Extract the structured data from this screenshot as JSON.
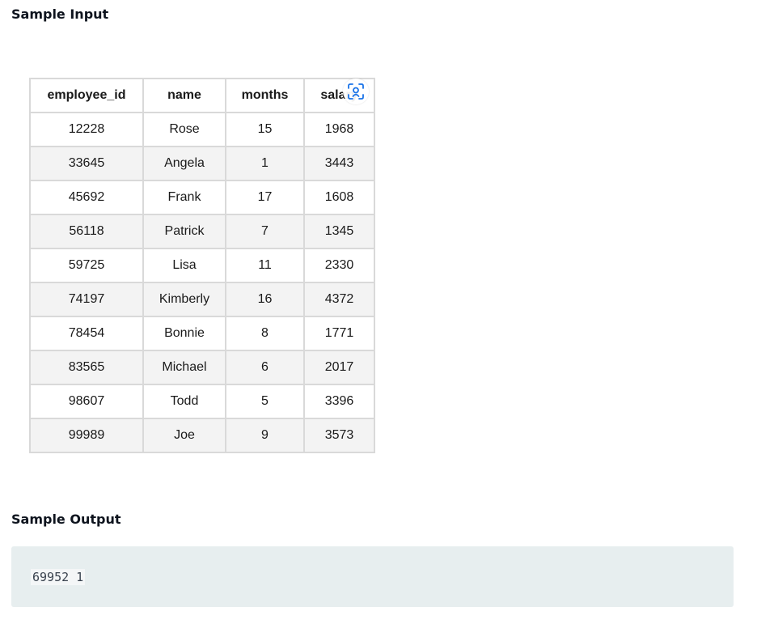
{
  "headings": {
    "input": "Sample Input",
    "output": "Sample Output"
  },
  "table": {
    "columns": [
      "employee_id",
      "name",
      "months",
      "salary"
    ],
    "rows": [
      [
        "12228",
        "Rose",
        "15",
        "1968"
      ],
      [
        "33645",
        "Angela",
        "1",
        "3443"
      ],
      [
        "45692",
        "Frank",
        "17",
        "1608"
      ],
      [
        "56118",
        "Patrick",
        "7",
        "1345"
      ],
      [
        "59725",
        "Lisa",
        "11",
        "2330"
      ],
      [
        "74197",
        "Kimberly",
        "16",
        "4372"
      ],
      [
        "78454",
        "Bonnie",
        "8",
        "1771"
      ],
      [
        "83565",
        "Michael",
        "6",
        "2017"
      ],
      [
        "98607",
        "Todd",
        "5",
        "3396"
      ],
      [
        "99989",
        "Joe",
        "9",
        "3573"
      ]
    ]
  },
  "overlay_icon": "lens-scan-icon",
  "output": {
    "text": "69952 1"
  },
  "colors": {
    "output_background": "#e7eeef",
    "table_border": "#d9d9d9",
    "row_stripe": "#f3f3f3",
    "icon_accent": "#1a73e8"
  }
}
